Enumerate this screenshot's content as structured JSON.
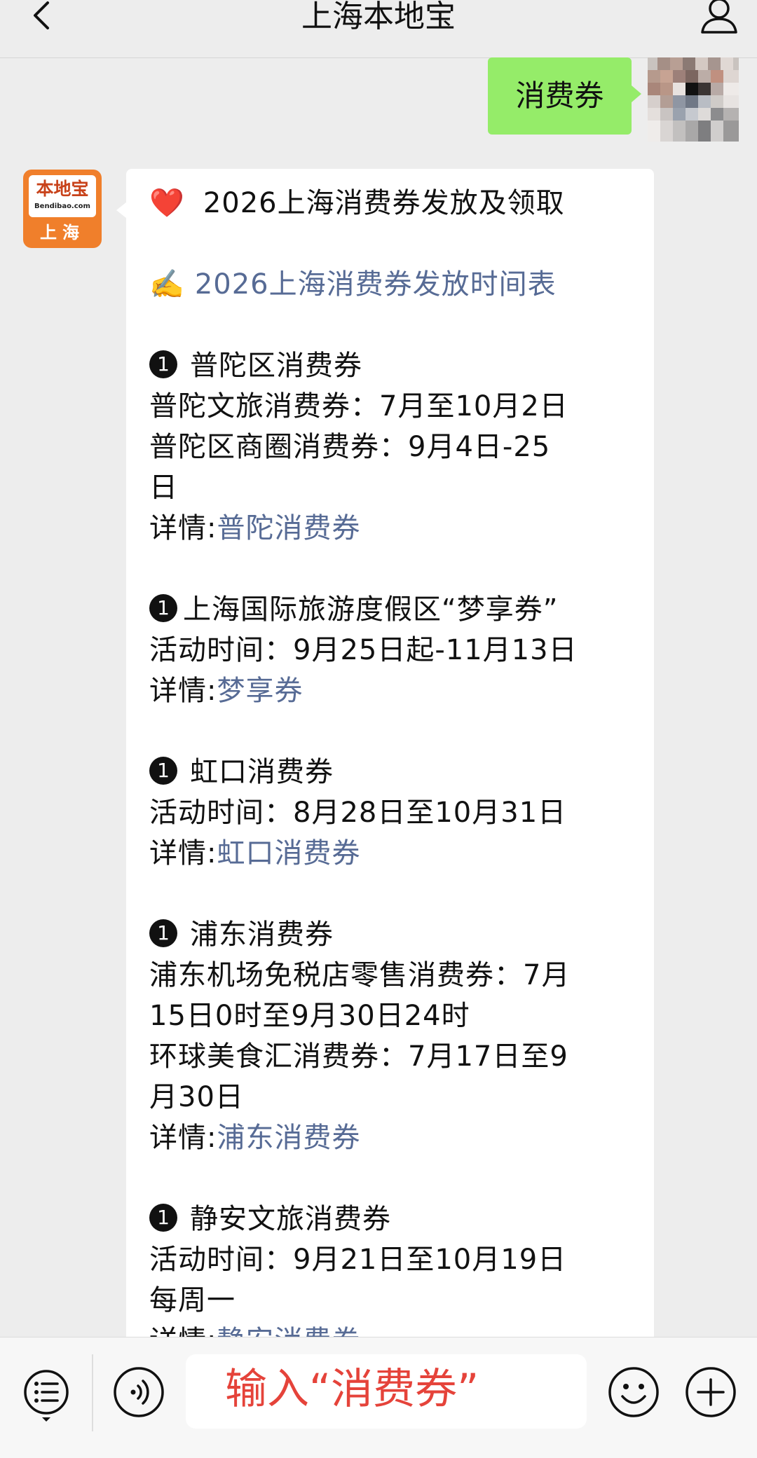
{
  "nav": {
    "title": "上海本地宝"
  },
  "outgoing": {
    "text": "消费券"
  },
  "sender_logo": {
    "brand": "本地宝",
    "url": "Bendibao.com",
    "city": "上海"
  },
  "message": {
    "heading": "2026上海消费券发放及领取",
    "subheading": "2026上海消费券发放时间表",
    "detail_prefix": "详情:",
    "sections": [
      {
        "title": "普陀区消费券",
        "lines": [
          "普陀文旅消费券：7月至10月2日",
          "普陀区商圈消费券：9月4日-25",
          "日"
        ],
        "link": "普陀消费券"
      },
      {
        "title": "上海国际旅游度假区“梦享券”",
        "lines": [
          "活动时间：9月25日起-11月13日"
        ],
        "link": "梦享券"
      },
      {
        "title": "虹口消费券",
        "lines": [
          "活动时间：8月28日至10月31日"
        ],
        "link": "虹口消费券"
      },
      {
        "title": "浦东消费券",
        "lines": [
          "浦东机场免税店零售消费券：7月",
          "15日0时至9月30日24时",
          "环球美食汇消费券：7月17日至9",
          "月30日"
        ],
        "link": "浦东消费券"
      },
      {
        "title": "静安文旅消费券",
        "lines": [
          "活动时间：9月21日至10月19日",
          "每周一"
        ],
        "link": "静安消费券"
      }
    ]
  },
  "input_bar": {
    "input_text": "输入“消费券”"
  },
  "icons": {
    "back": "chevron-left-icon",
    "profile": "person-icon",
    "menu": "menu-list-icon",
    "voice": "voice-icon",
    "emoji": "emoji-icon",
    "plus": "plus-icon"
  },
  "colors": {
    "chat_background": "#ededed",
    "outgoing_bubble": "#95ec69",
    "link": "#576b95",
    "logo_orange": "#f07f2b",
    "input_hint": "#e5433a",
    "heart": "#e0262b"
  }
}
